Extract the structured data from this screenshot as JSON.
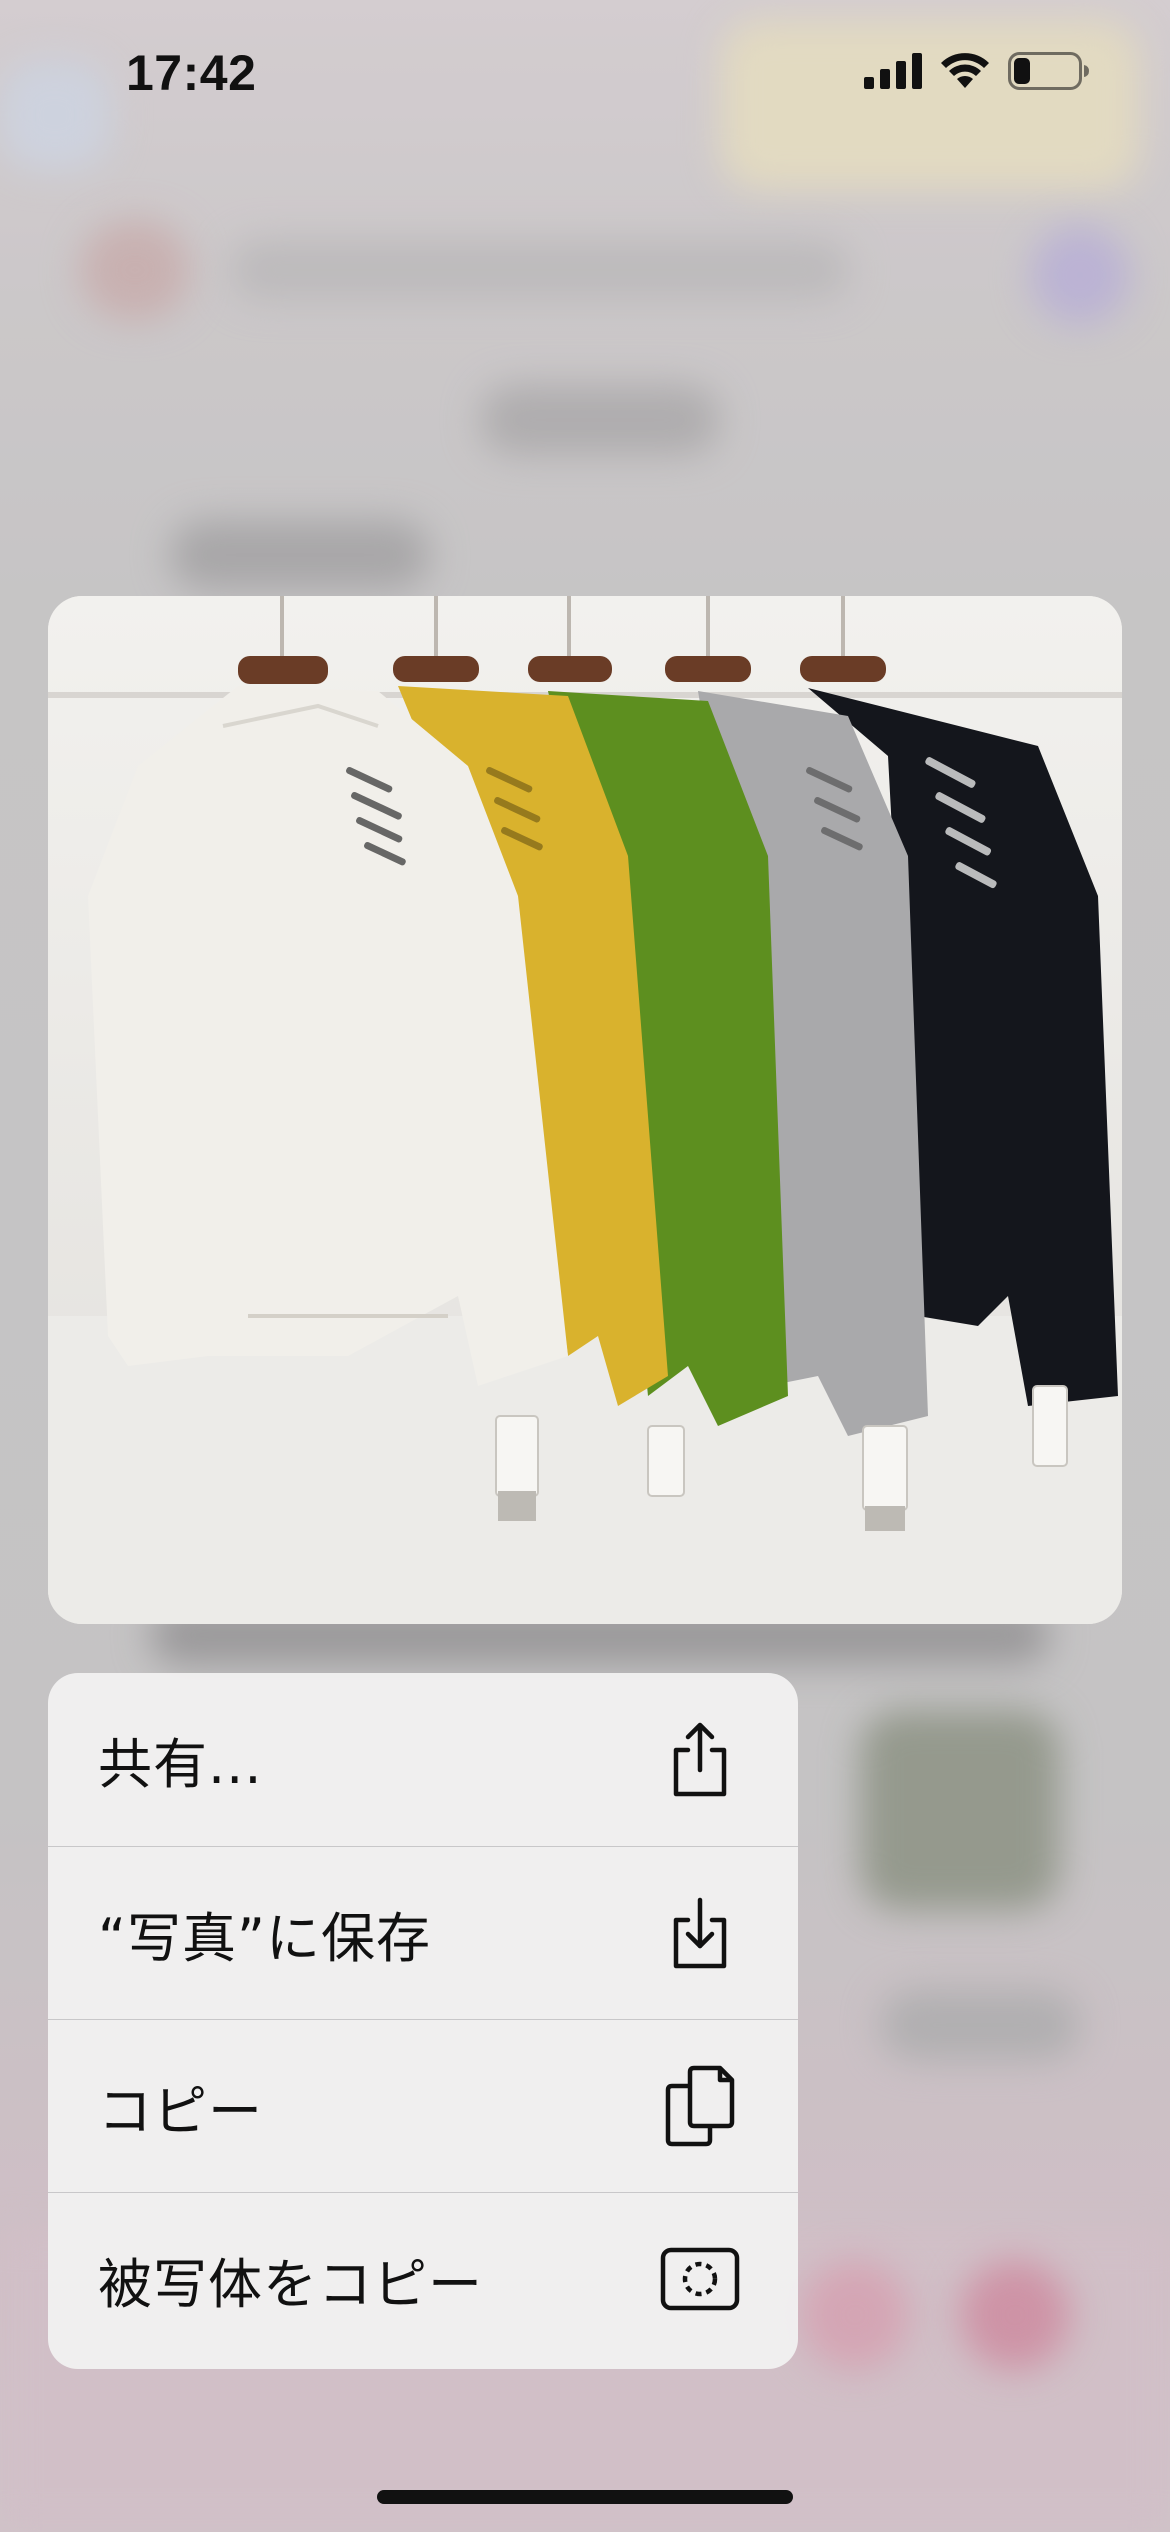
{
  "status_bar": {
    "time": "17:42",
    "signal_icon": "cellular-signal-icon",
    "wifi_icon": "wifi-icon",
    "battery_icon": "battery-low-icon"
  },
  "preview": {
    "image_icon": "photo-preview-image",
    "colors": [
      "#f1efea",
      "#d9b22d",
      "#5d8f1f",
      "#a9a9ab",
      "#14161c"
    ]
  },
  "context_menu": {
    "items": [
      {
        "label": "共有...",
        "icon": "share-icon"
      },
      {
        "label": "“写真”に保存",
        "icon": "save-to-photos-icon"
      },
      {
        "label": "コピー",
        "icon": "copy-icon"
      },
      {
        "label": "被写体をコピー",
        "icon": "copy-subject-icon"
      }
    ]
  }
}
